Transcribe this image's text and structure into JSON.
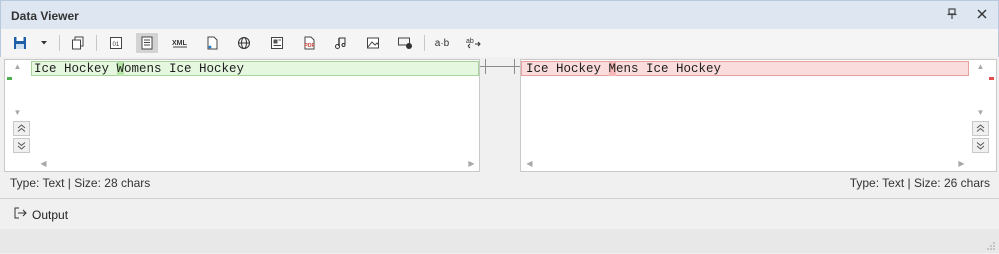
{
  "window": {
    "title": "Data Viewer",
    "pin_icon": "pin-icon",
    "close_icon": "close-icon"
  },
  "toolbar": {
    "items": [
      {
        "name": "save-icon"
      },
      {
        "name": "dropdown-icon"
      },
      {
        "name": "copy-icon"
      },
      {
        "name": "hex-icon"
      },
      {
        "name": "text-icon"
      },
      {
        "name": "xml-icon"
      },
      {
        "name": "json-icon"
      },
      {
        "name": "web-icon"
      },
      {
        "name": "rtf-icon"
      },
      {
        "name": "pdf-icon"
      },
      {
        "name": "wave-icon"
      },
      {
        "name": "image-icon"
      },
      {
        "name": "spatial-icon"
      },
      {
        "name": "ab-compare-icon"
      },
      {
        "name": "swap-icon"
      }
    ],
    "ab_label": "a·b"
  },
  "left_pane": {
    "text_before": "Ice Hockey ",
    "text_changed": "W",
    "text_after": "omens Ice Hockey",
    "status": "Type: Text | Size: 28 chars"
  },
  "right_pane": {
    "text_before": "Ice Hockey ",
    "text_changed": "M",
    "text_after": "ens Ice Hockey",
    "status": "Type: Text | Size: 26 chars"
  },
  "footer": {
    "output_label": "Output"
  },
  "colors": {
    "added_bg": "#e6f7e0",
    "removed_bg": "#fbdcdc",
    "titlebar": "#dde6f1"
  }
}
